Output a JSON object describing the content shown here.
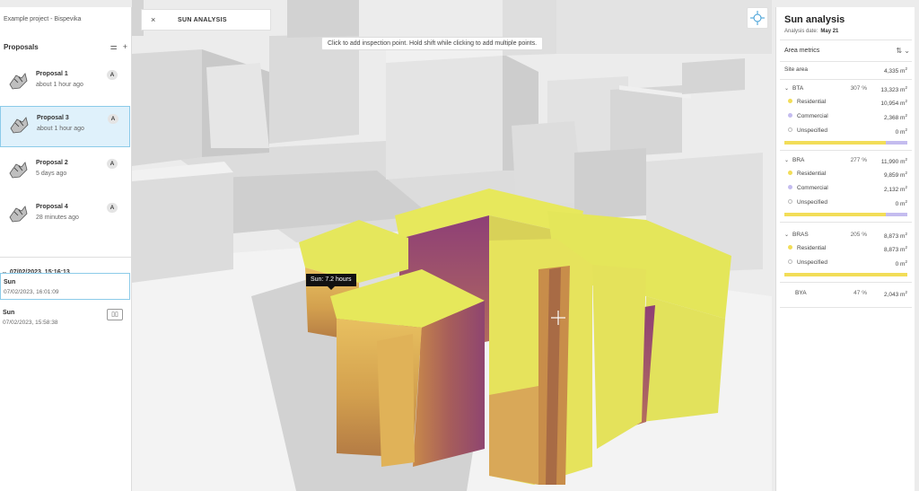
{
  "project": {
    "name": "Example project - Bispevika"
  },
  "proposals": {
    "title": "Proposals",
    "items": [
      {
        "title": "Proposal 1",
        "time": "about 1 hour ago",
        "badge": "A",
        "selected": false
      },
      {
        "title": "Proposal 3",
        "time": "about 1 hour ago",
        "badge": "A",
        "selected": true
      },
      {
        "title": "Proposal 2",
        "time": "5 days ago",
        "badge": "A",
        "selected": false
      },
      {
        "title": "Proposal 4",
        "time": "28 minutes ago",
        "badge": "A",
        "selected": false
      }
    ]
  },
  "analysis_group": {
    "label": "07/02/2023, 15:16:13",
    "runs": [
      {
        "title": "Sun",
        "time": "07/02/2023, 16:01:09",
        "selected": true
      },
      {
        "title": "Sun",
        "time": "07/02/2023, 15:58:38",
        "selected": false
      }
    ]
  },
  "tab": {
    "title": "SUN ANALYSIS",
    "close": "×"
  },
  "hint": "Click to add inspection point. Hold shift while clicking to add multiple points.",
  "tooltip": "Sun: 7.2 hours",
  "right_panel": {
    "title": "Sun analysis",
    "date_label": "Analysis date:",
    "date_value": "May 21",
    "metrics_title": "Area metrics",
    "site_area": {
      "label": "Site area",
      "value": "4,335 m",
      "unit_sup": "2"
    },
    "groups": [
      {
        "label": "BTA",
        "pct": "307 %",
        "value": "13,323 m",
        "rows": [
          {
            "label": "Residential",
            "value": "10,954 m",
            "dot": "#f2dd58"
          },
          {
            "label": "Commercial",
            "value": "2,368 m",
            "dot": "#c4bcef"
          },
          {
            "label": "Unspecified",
            "value": "0 m",
            "dot": "#ffffff"
          }
        ],
        "bar": {
          "residential": 0.822,
          "commercial": 0.178
        }
      },
      {
        "label": "BRA",
        "pct": "277 %",
        "value": "11,990 m",
        "rows": [
          {
            "label": "Residential",
            "value": "9,859 m",
            "dot": "#f2dd58"
          },
          {
            "label": "Commercial",
            "value": "2,132 m",
            "dot": "#c4bcef"
          },
          {
            "label": "Unspecified",
            "value": "0 m",
            "dot": "#ffffff"
          }
        ],
        "bar": {
          "residential": 0.822,
          "commercial": 0.178
        }
      },
      {
        "label": "BRAS",
        "pct": "205 %",
        "value": "8,873 m",
        "rows": [
          {
            "label": "Residential",
            "value": "8,873 m",
            "dot": "#f2dd58"
          },
          {
            "label": "Unspecified",
            "value": "0 m",
            "dot": "#ffffff"
          }
        ],
        "bar": {
          "residential": 1.0,
          "commercial": 0.0
        }
      }
    ],
    "bya": {
      "label": "BYA",
      "pct": "47 %",
      "value": "2,043 m"
    },
    "unit_sup": "2"
  },
  "colors": {
    "accent": "#3a9bd5",
    "selected_bg": "#dff1fb",
    "residential": "#f2dd58",
    "commercial": "#c4bcef",
    "sun_high": "#e6e85a",
    "sun_low": "#8a3a78"
  },
  "icons": [
    "sliders-icon",
    "plus-icon",
    "chevron-down-icon",
    "compare-icon",
    "close-icon",
    "target-icon",
    "sort-icon",
    "cursor-crosshair-icon"
  ]
}
